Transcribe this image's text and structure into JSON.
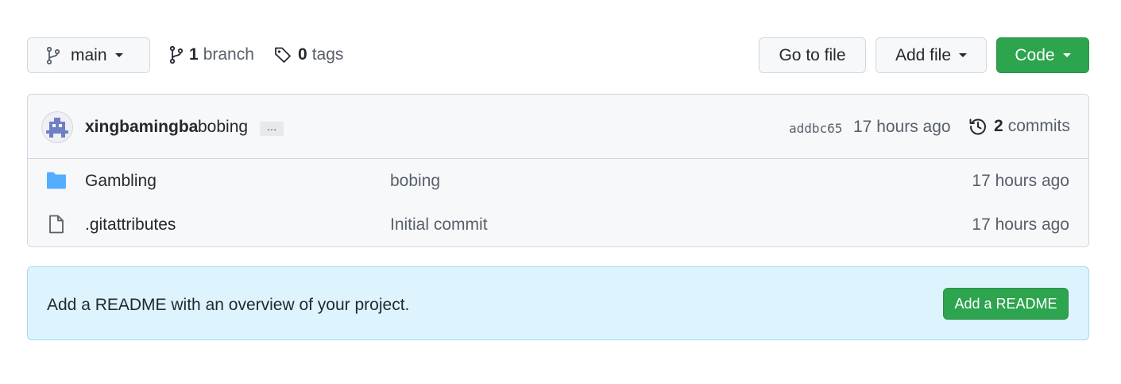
{
  "toolbar": {
    "branch_label": "main",
    "branches_count": "1",
    "branches_label": "branch",
    "tags_count": "0",
    "tags_label": "tags",
    "goto_file_label": "Go to file",
    "add_file_label": "Add file",
    "code_label": "Code"
  },
  "latest_commit": {
    "author": "xingbamingba",
    "message": "bobing",
    "ellipsis": "…",
    "sha": "addbc65",
    "time": "17 hours ago",
    "commits_count": "2",
    "commits_label": "commits"
  },
  "files": [
    {
      "name": "Gambling",
      "type": "folder",
      "icon": "folder-icon",
      "message": "bobing",
      "time": "17 hours ago"
    },
    {
      "name": ".gitattributes",
      "type": "file",
      "icon": "file-icon",
      "message": "Initial commit",
      "time": "17 hours ago"
    }
  ],
  "readme_banner": {
    "text": "Add a README with an overview of your project.",
    "button_label": "Add a README"
  },
  "colors": {
    "accent_green": "#2da44e",
    "folder_blue": "#54aeff",
    "banner_bg": "#ddf4ff",
    "muted_text": "#57606a"
  }
}
